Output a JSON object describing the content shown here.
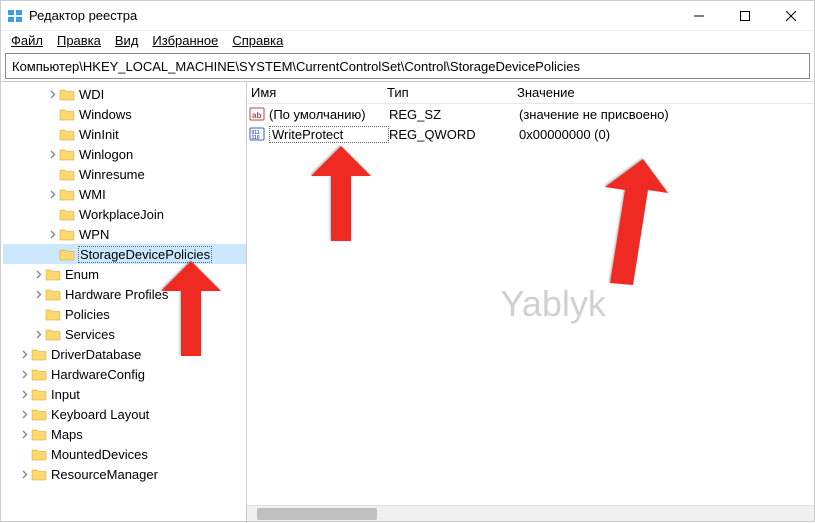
{
  "window": {
    "title": "Редактор реестра"
  },
  "menu": {
    "file": "Файл",
    "edit": "Правка",
    "view": "Вид",
    "favorites": "Избранное",
    "help": "Справка"
  },
  "address": "Компьютер\\HKEY_LOCAL_MACHINE\\SYSTEM\\CurrentControlSet\\Control\\StorageDevicePolicies",
  "tree": {
    "items": [
      {
        "label": "WDI",
        "level": 2,
        "expandable": true
      },
      {
        "label": "Windows",
        "level": 2,
        "expandable": false
      },
      {
        "label": "WinInit",
        "level": 2,
        "expandable": false
      },
      {
        "label": "Winlogon",
        "level": 2,
        "expandable": true
      },
      {
        "label": "Winresume",
        "level": 2,
        "expandable": false
      },
      {
        "label": "WMI",
        "level": 2,
        "expandable": true
      },
      {
        "label": "WorkplaceJoin",
        "level": 2,
        "expandable": false
      },
      {
        "label": "WPN",
        "level": 2,
        "expandable": true
      },
      {
        "label": "StorageDevicePolicies",
        "level": 2,
        "expandable": false,
        "selected": true
      },
      {
        "label": "Enum",
        "level": 1,
        "expandable": true
      },
      {
        "label": "Hardware Profiles",
        "level": 1,
        "expandable": true
      },
      {
        "label": "Policies",
        "level": 1,
        "expandable": false
      },
      {
        "label": "Services",
        "level": 1,
        "expandable": true
      },
      {
        "label": "DriverDatabase",
        "level": 0,
        "expandable": true
      },
      {
        "label": "HardwareConfig",
        "level": 0,
        "expandable": true
      },
      {
        "label": "Input",
        "level": 0,
        "expandable": true
      },
      {
        "label": "Keyboard Layout",
        "level": 0,
        "expandable": true
      },
      {
        "label": "Maps",
        "level": 0,
        "expandable": true
      },
      {
        "label": "MountedDevices",
        "level": 0,
        "expandable": false
      },
      {
        "label": "ResourceManager",
        "level": 0,
        "expandable": true
      }
    ]
  },
  "list": {
    "headers": {
      "name": "Имя",
      "type": "Тип",
      "value": "Значение"
    },
    "rows": [
      {
        "icon": "string",
        "name": "(По умолчанию)",
        "type": "REG_SZ",
        "value": "(значение не присвоено)"
      },
      {
        "icon": "binary",
        "name": "WriteProtect",
        "type": "REG_QWORD",
        "value": "0x00000000 (0)",
        "selected": true
      }
    ]
  },
  "watermark": "Yablyk"
}
